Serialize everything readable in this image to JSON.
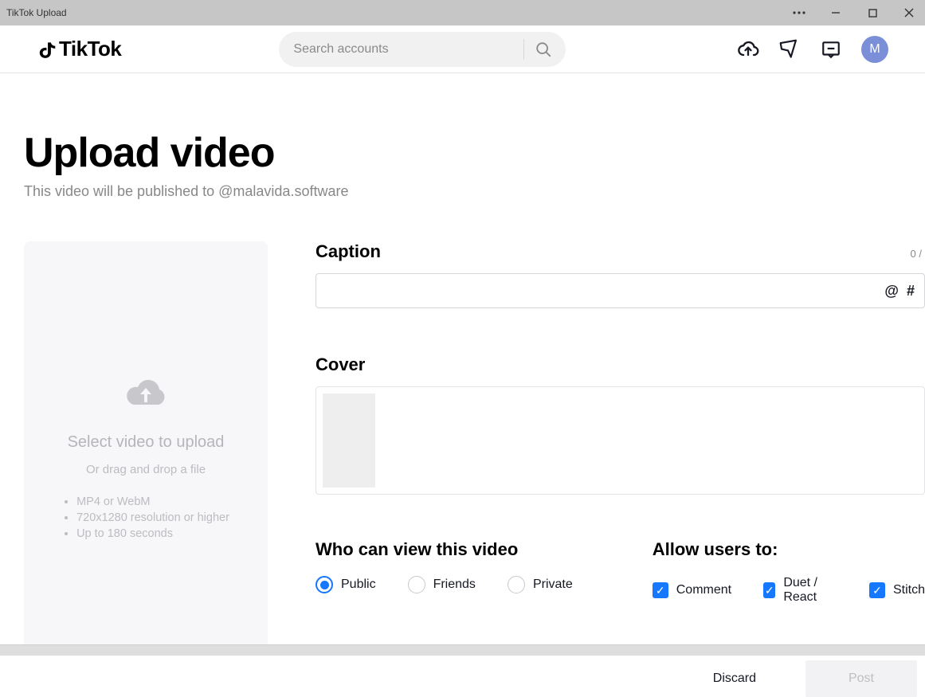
{
  "window": {
    "title": "TikTok Upload"
  },
  "nav": {
    "brand": "TikTok",
    "search_placeholder": "Search accounts",
    "avatar_initial": "M"
  },
  "page": {
    "title": "Upload video",
    "subtitle": "This video will be published to @malavida.software"
  },
  "dropzone": {
    "title": "Select video to upload",
    "subtitle": "Or drag and drop a file",
    "hints": [
      "MP4 or WebM",
      "720x1280 resolution or higher",
      "Up to 180 seconds"
    ]
  },
  "caption": {
    "label": "Caption",
    "count": "0 /",
    "value": "",
    "at": "@",
    "hash": "#"
  },
  "cover": {
    "label": "Cover"
  },
  "privacy": {
    "label": "Who can view this video",
    "options": [
      {
        "label": "Public",
        "checked": true
      },
      {
        "label": "Friends",
        "checked": false
      },
      {
        "label": "Private",
        "checked": false
      }
    ]
  },
  "allow": {
    "label": "Allow users to:",
    "options": [
      {
        "label": "Comment",
        "checked": true
      },
      {
        "label": "Duet / React",
        "checked": true
      },
      {
        "label": "Stitch",
        "checked": true
      }
    ]
  },
  "actions": {
    "discard": "Discard",
    "post": "Post"
  }
}
